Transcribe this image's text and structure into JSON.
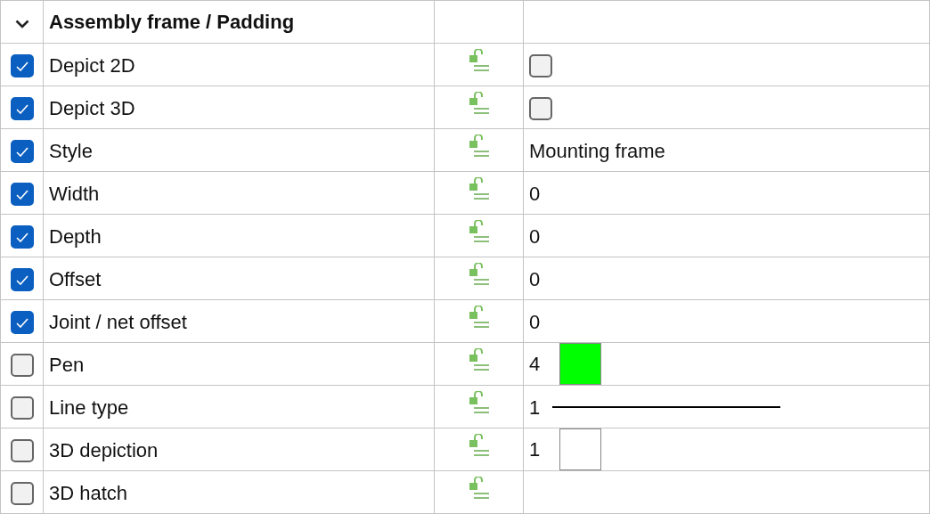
{
  "group": {
    "title": "Assembly frame / Padding",
    "expanded": true
  },
  "rows": [
    {
      "label": "Depict 2D",
      "checked": true,
      "kind": "checkbox",
      "value_checked": false
    },
    {
      "label": "Depict 3D",
      "checked": true,
      "kind": "checkbox",
      "value_checked": false
    },
    {
      "label": "Style",
      "checked": true,
      "kind": "text",
      "value": "Mounting frame"
    },
    {
      "label": "Width",
      "checked": true,
      "kind": "text",
      "value": "0"
    },
    {
      "label": "Depth",
      "checked": true,
      "kind": "text",
      "value": "0"
    },
    {
      "label": "Offset",
      "checked": true,
      "kind": "text",
      "value": "0"
    },
    {
      "label": "Joint / net offset",
      "checked": true,
      "kind": "text",
      "value": "0"
    },
    {
      "label": "Pen",
      "checked": false,
      "kind": "swatch",
      "value": "4",
      "color": "#00ff00"
    },
    {
      "label": "Line type",
      "checked": false,
      "kind": "line",
      "value": "1"
    },
    {
      "label": "3D depiction",
      "checked": false,
      "kind": "swatch",
      "value": "1",
      "color": "#ffffff"
    },
    {
      "label": "3D hatch",
      "checked": false,
      "kind": "empty"
    }
  ]
}
